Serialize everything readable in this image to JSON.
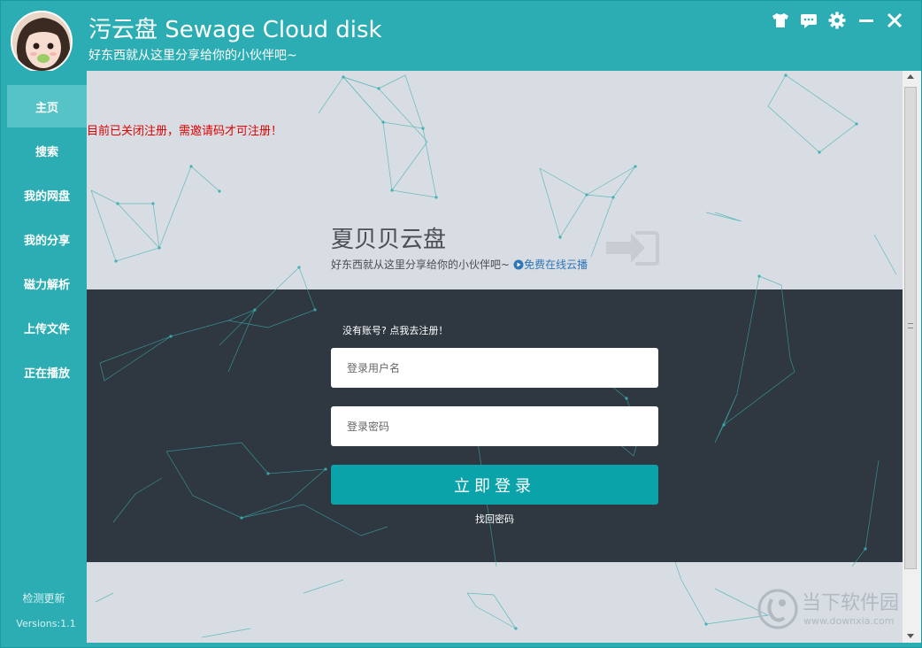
{
  "app": {
    "title": "污云盘 Sewage Cloud disk",
    "subtitle": "好东西就从这里分享给你的小伙伴吧~"
  },
  "window_controls": [
    "shirt-icon",
    "feedback-icon",
    "gear-icon",
    "minimize-icon",
    "close-icon"
  ],
  "sidebar": {
    "items": [
      {
        "label": "主页",
        "active": true
      },
      {
        "label": "搜索"
      },
      {
        "label": "我的网盘"
      },
      {
        "label": "我的分享"
      },
      {
        "label": "磁力解析"
      },
      {
        "label": "上传文件"
      },
      {
        "label": "正在播放"
      }
    ],
    "update_label": "检测更新",
    "version": "Versions:1.1"
  },
  "main": {
    "notice": "目前已关闭注册，需邀请码才可注册！",
    "brand_title": "夏贝贝云盘",
    "brand_subtitle": "好东西就从这里分享给你的小伙伴吧~",
    "play_link": "免费在线云播",
    "register_link": "没有账号? 点我去注册！",
    "username_placeholder": "登录用户名",
    "password_placeholder": "登录密码",
    "login_button": "立即登录",
    "forgot_link": "找回密码"
  },
  "watermark": {
    "cn": "当下软件园",
    "en": "www.downxia.com"
  },
  "colors": {
    "teal": "#2badb3",
    "active_nav": "#55c3c8",
    "dark_band": "#2f3740",
    "light_bg": "#d7dde3",
    "button": "#0aa3a9",
    "notice": "#e00000",
    "link": "#2f75b8"
  }
}
